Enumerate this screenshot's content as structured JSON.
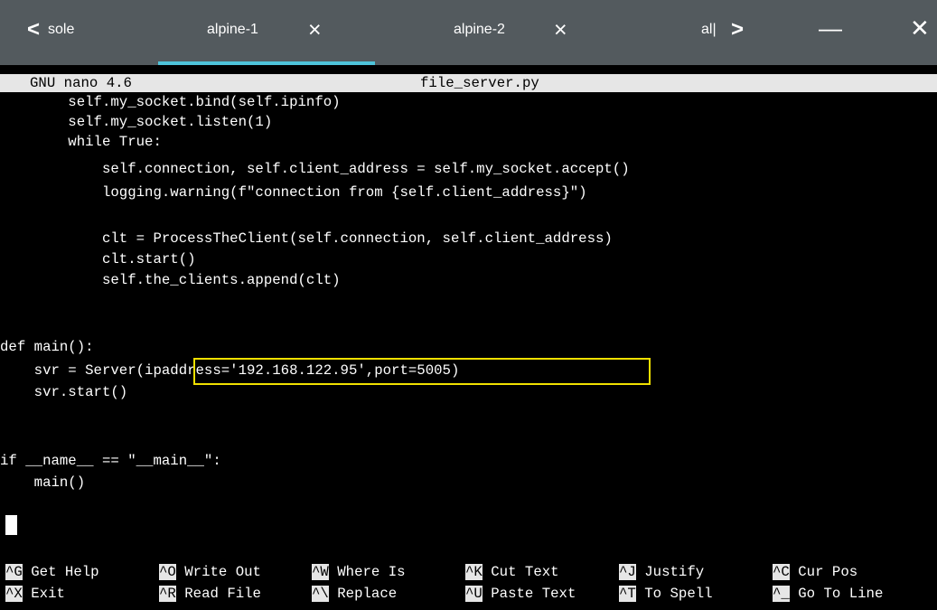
{
  "tabs": {
    "left_arrow": "<",
    "right_arrow": ">",
    "items": [
      {
        "label": "sole"
      },
      {
        "label": "alpine-1",
        "close": "×"
      },
      {
        "label": "alpine-2",
        "close": "×"
      },
      {
        "label": "al|"
      }
    ],
    "minimize": "—",
    "close": "✕",
    "accent_color": "#4ec3d9",
    "bar_color": "#535a5e"
  },
  "nano": {
    "version": "GNU nano 4.6",
    "filename": "file_server.py"
  },
  "code_lines": [
    "        self.my_socket.bind(self.ipinfo)",
    "        self.my_socket.listen(1)",
    "        while True:",
    "            self.connection, self.client_address = self.my_socket.accept()",
    "            logging.warning(f\"connection from {self.client_address}\")",
    "",
    "            clt = ProcessTheClient(self.connection, self.client_address)",
    "            clt.start()",
    "            self.the_clients.append(clt)",
    "",
    "",
    "def main():",
    "    svr = Server(ipaddress='192.168.122.95',port=5005)",
    "    svr.start()",
    "",
    "",
    "if __name__ == \"__main__\":",
    "    main()"
  ],
  "highlight_color": "#f0e000",
  "shortcuts": [
    {
      "key": "^G",
      "label": "Get Help"
    },
    {
      "key": "^O",
      "label": "Write Out"
    },
    {
      "key": "^W",
      "label": "Where Is"
    },
    {
      "key": "^K",
      "label": "Cut Text"
    },
    {
      "key": "^J",
      "label": "Justify"
    },
    {
      "key": "^C",
      "label": "Cur Pos"
    },
    {
      "key": "^X",
      "label": "Exit"
    },
    {
      "key": "^R",
      "label": "Read File"
    },
    {
      "key": "^\\",
      "label": "Replace"
    },
    {
      "key": "^U",
      "label": "Paste Text"
    },
    {
      "key": "^T",
      "label": "To Spell"
    },
    {
      "key": "^_",
      "label": "Go To Line"
    }
  ]
}
